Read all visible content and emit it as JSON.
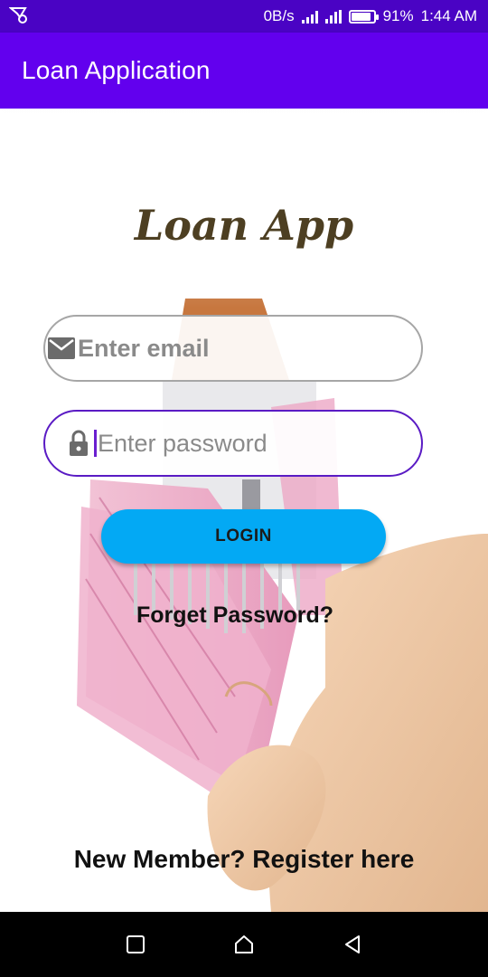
{
  "status_bar": {
    "network_speed": "0B/s",
    "battery_percent": "91%",
    "battery_level": 0.91,
    "time": "1:44 AM",
    "icons": [
      "notification-icon",
      "signal-icon",
      "battery-icon"
    ]
  },
  "app_bar": {
    "title": "Loan Application"
  },
  "login": {
    "logo_title": "Loan App",
    "email_placeholder": "Enter email",
    "email_value": "",
    "password_placeholder": "Enter password",
    "password_value": "",
    "login_label": "LOGIN",
    "forgot_label": "Forget Password?",
    "register_label": "New Member? Register here"
  },
  "nav_bar": {
    "buttons": [
      "recents-icon",
      "home-icon",
      "back-icon"
    ]
  },
  "colors": {
    "status_bar": "#4a03c4",
    "app_bar": "#6200ee",
    "login_button": "#03a9f4",
    "password_border": "#5a1bc4",
    "title_text": "#4d3f22"
  }
}
